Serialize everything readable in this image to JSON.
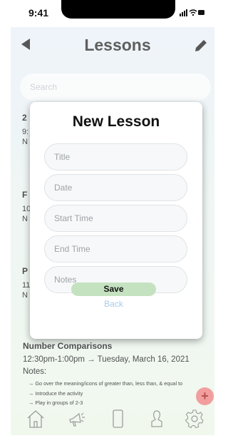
{
  "status_bar": {
    "time": "9:41",
    "icons": "signal wifi battery"
  },
  "header": {
    "title": "Lessons",
    "back_icon": "back-arrow-icon",
    "edit_icon": "pencil-icon"
  },
  "search": {
    "placeholder": "Search"
  },
  "background_cards": [
    {
      "title_peek": "2",
      "line2_peek": "9:",
      "line3_peek": "N"
    },
    {
      "title_peek": "F",
      "line2_peek": "10",
      "line3_peek": "N"
    },
    {
      "title_peek": "P",
      "line2_peek": "11",
      "line3_peek": "N"
    }
  ],
  "lesson_card": {
    "title": "Number Comparisons",
    "time": "12:30pm-1:00pm → Tuesday, March 16, 2021",
    "notes_label": "Notes:",
    "bullets": [
      "→ Go over the meaning/icons of greater than, less than, & equal to",
      "→ Introduce the activity",
      "→ Play in groups of 2-3"
    ]
  },
  "fab": {
    "label": "+"
  },
  "modal": {
    "title": "New Lesson",
    "fields": [
      {
        "placeholder": "Title"
      },
      {
        "placeholder": "Date"
      },
      {
        "placeholder": "Start Time"
      },
      {
        "placeholder": "End Time"
      },
      {
        "placeholder": "Notes"
      }
    ],
    "save_label": "Save",
    "back_label": "Back"
  },
  "tabbar": {
    "items": [
      "home-icon",
      "megaphone-icon",
      "phone-icon",
      "person-icon",
      "settings-gear-icon"
    ]
  },
  "colors": {
    "save_button": "#c5e2c0",
    "back_link": "#a9cbe8",
    "fab": "#f08d8d"
  }
}
